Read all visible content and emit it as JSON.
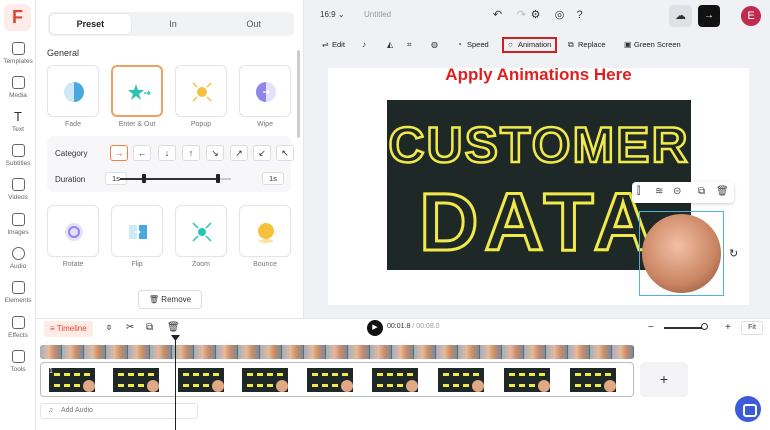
{
  "nav": {
    "items": [
      {
        "label": "Templates"
      },
      {
        "label": "Media"
      },
      {
        "label": "Text"
      },
      {
        "label": "Subtitles"
      },
      {
        "label": "Videos"
      },
      {
        "label": "Images"
      },
      {
        "label": "Audio"
      },
      {
        "label": "Elements"
      },
      {
        "label": "Effects"
      },
      {
        "label": "Tools"
      }
    ]
  },
  "panel": {
    "tabs": [
      "Preset",
      "In",
      "Out"
    ],
    "active_tab": "Preset",
    "section": "General",
    "general_effects": [
      "Fade",
      "Enter & Out",
      "Popup",
      "Wipe"
    ],
    "selected_effect": "Enter & Out",
    "category_label": "Category",
    "duration_label": "Duration",
    "duration_start": "1s",
    "duration_end": "1s",
    "more_effects": [
      "Rotate",
      "Flip",
      "Zoom",
      "Bounce"
    ],
    "remove_label": "Remove",
    "colors": {
      "accent": "#f08040",
      "teal": "#2bc4b0",
      "yellow": "#f6c23e",
      "purple": "#8f86e8"
    }
  },
  "topbar": {
    "ratio": "16:9",
    "title": "Untitled",
    "avatar_letter": "E",
    "avatar_color": "#c02a4d"
  },
  "toolbar": {
    "items": [
      "Edit",
      "Speed",
      "Animation",
      "Replace",
      "Green Screen"
    ],
    "highlighted": "Animation"
  },
  "canvas": {
    "headline": "Apply Animations Here",
    "headline_color": "#e02020",
    "chalk_text_1": "CUSTOMER",
    "chalk_text_2": "DATA",
    "chalk_color": "#f1e84a"
  },
  "timeline": {
    "label": "Timeline",
    "current_time": "00:01.8",
    "separator": " / ",
    "total_time": "00:08.0",
    "fit_label": "Fit",
    "add_audio_label": "Add Audio",
    "clip_number": "1",
    "add_clip_symbol": "+"
  }
}
